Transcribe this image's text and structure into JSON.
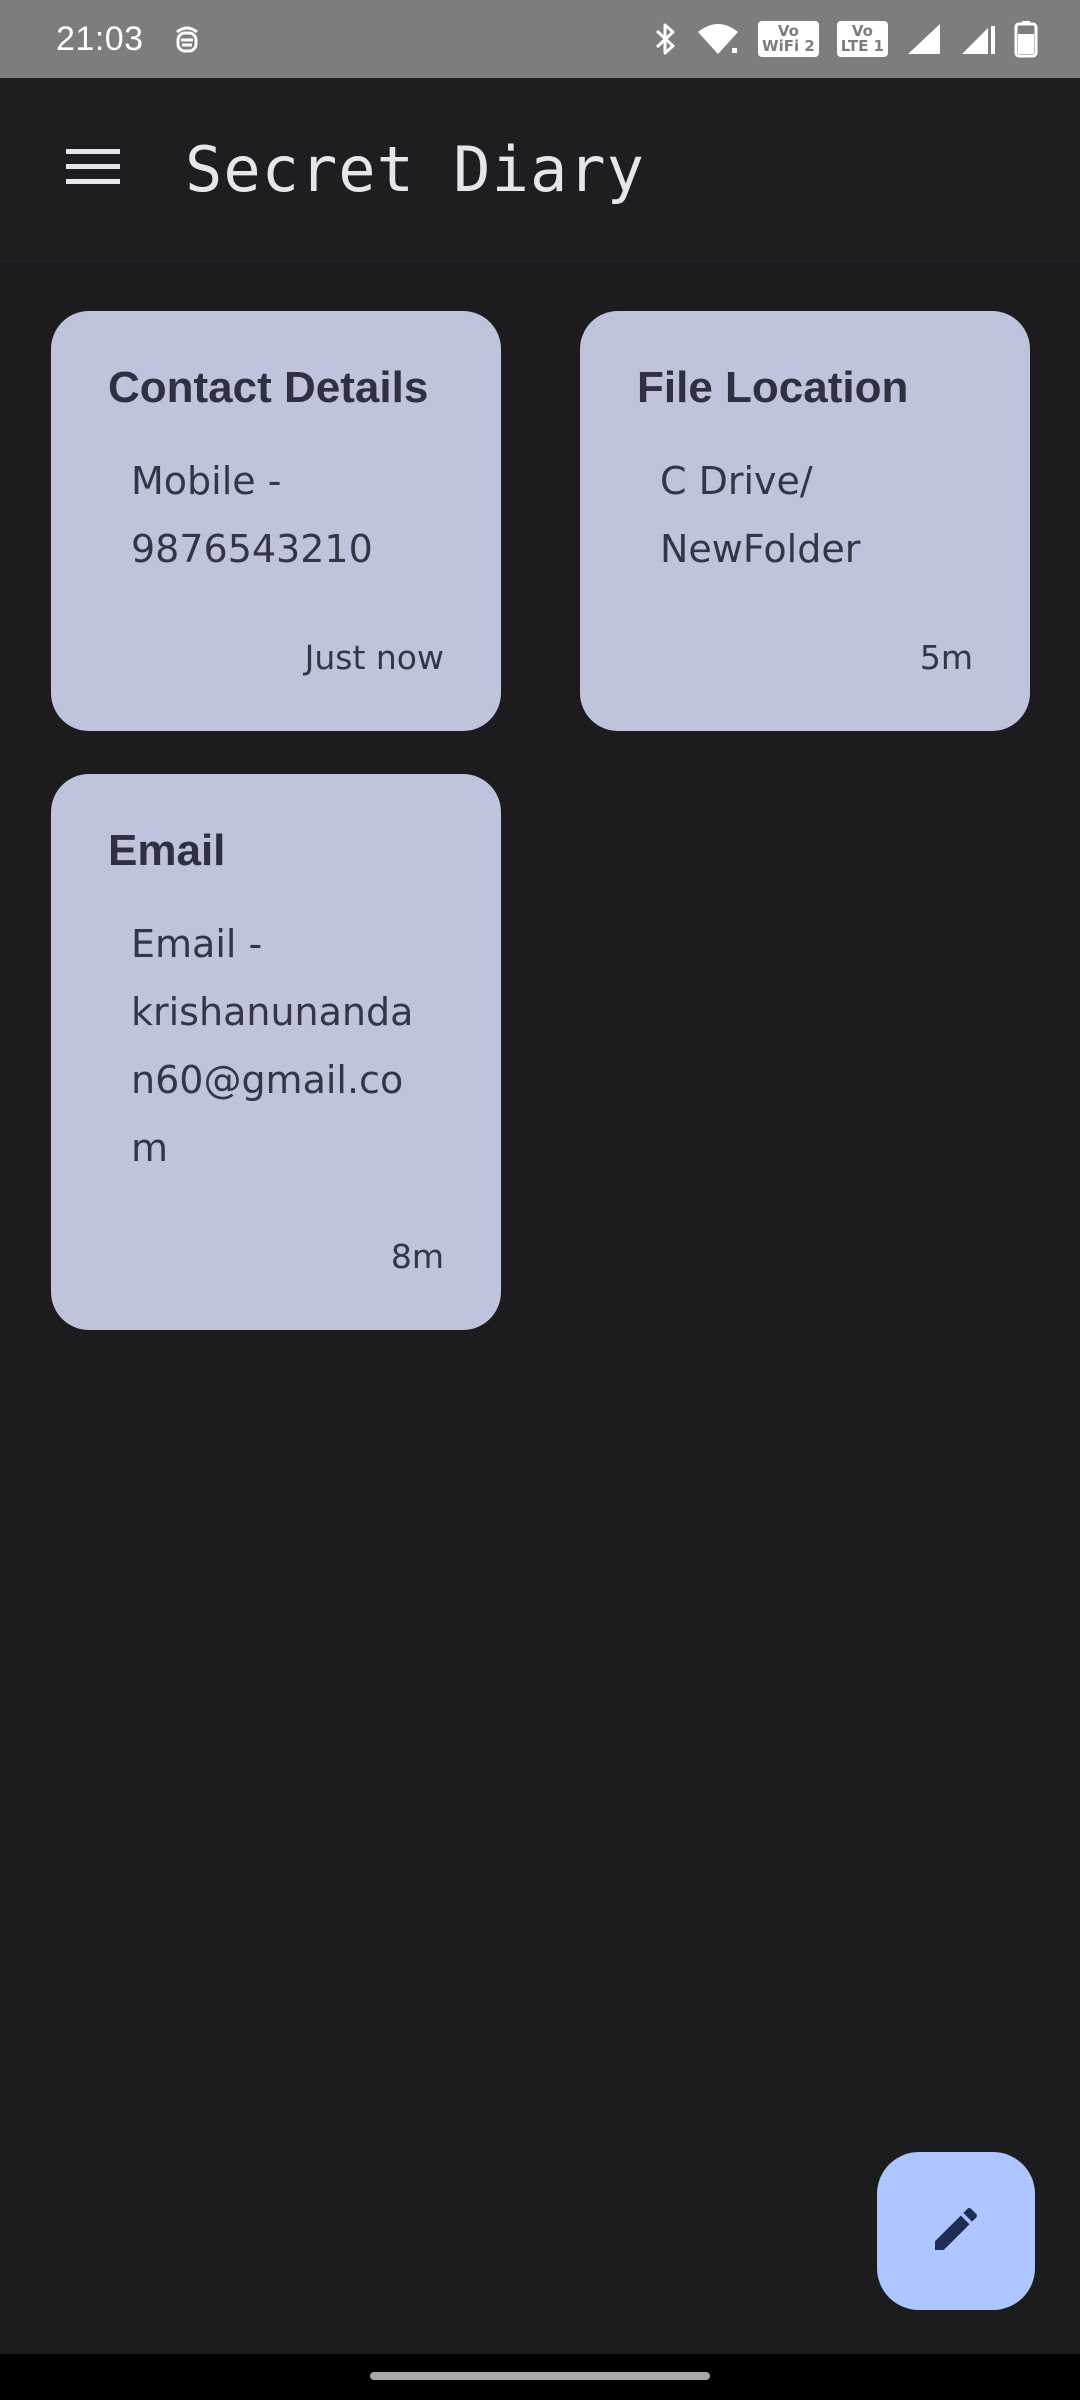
{
  "status_bar": {
    "time": "21:03",
    "icons": [
      "notification-app-icon",
      "bluetooth-icon",
      "wifi-icon",
      "vowifi-icon",
      "volte-icon",
      "signal-icon",
      "signal-icon-2",
      "battery-icon"
    ],
    "vowifi_top": "Vo",
    "vowifi_bottom": "WiFi 2",
    "volte_top": "Vo",
    "volte_bottom": "LTE 1"
  },
  "app_bar": {
    "title": "Secret Diary",
    "menu_icon": "menu-icon"
  },
  "notes": [
    {
      "title": "Contact Details",
      "body": "Mobile -\n9876543210",
      "time": "Just now"
    },
    {
      "title": "File Location",
      "body": "C Drive/\nNewFolder",
      "time": "5m"
    },
    {
      "title": "Email",
      "body": "Email -\nkrishanunandan60@gmail.com",
      "time": "8m"
    }
  ],
  "fab": {
    "icon": "pencil-icon"
  },
  "colors": {
    "background": "#1c1c1f",
    "card": "#bfc4dc",
    "fab": "#aec6ff",
    "status_bar": "#7d7d7d"
  }
}
